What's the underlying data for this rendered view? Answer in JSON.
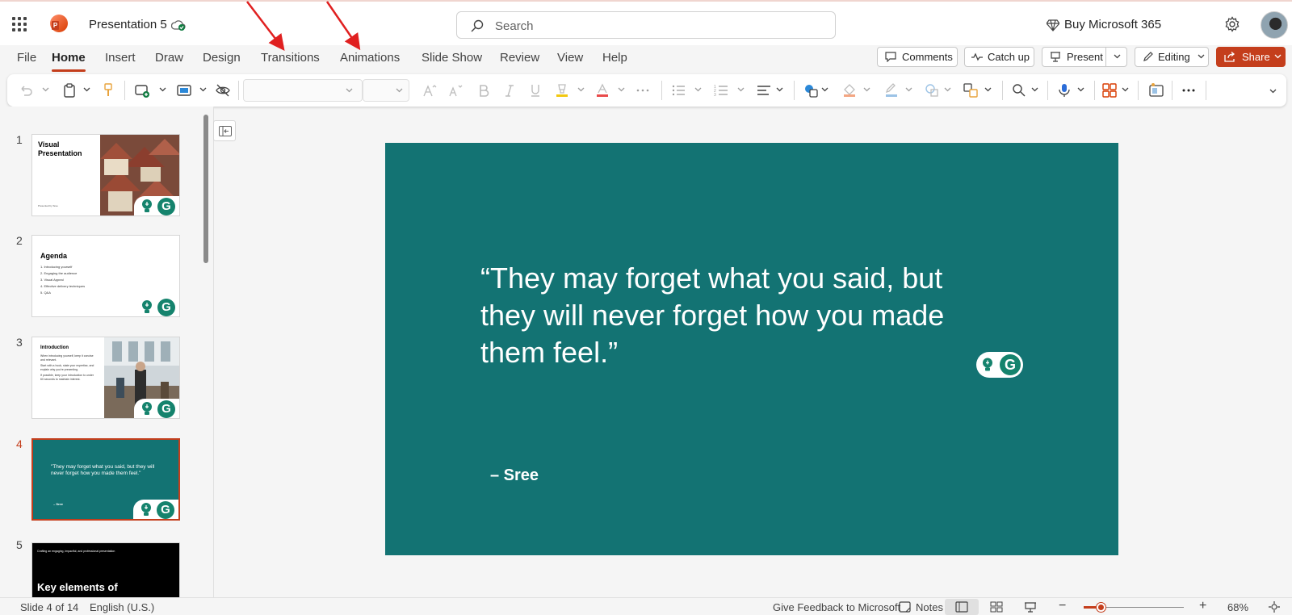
{
  "titlebar": {
    "doc_title": "Presentation 5",
    "search_placeholder": "Search",
    "buy": "Buy Microsoft 365"
  },
  "tabs": [
    "File",
    "Home",
    "Insert",
    "Draw",
    "Design",
    "Transitions",
    "Animations",
    "Slide Show",
    "Review",
    "View",
    "Help"
  ],
  "active_tab": "Home",
  "ribbon_buttons": {
    "comments": "Comments",
    "catch_up": "Catch up",
    "present": "Present",
    "editing": "Editing",
    "share": "Share"
  },
  "slides": [
    {
      "number": "1",
      "title": "Visual Presentation",
      "subtitle": "Presented by Sree"
    },
    {
      "number": "2",
      "title": "Agenda",
      "items": [
        "1.  Introducing yourself",
        "2.  Engaging the audience",
        "3.  Visual Appeal",
        "4.  Effective delivery techniques",
        "5.  Q&A"
      ]
    },
    {
      "number": "3",
      "title": "Introduction",
      "body": [
        "When introducing yourself, keep it concise and relevant.",
        "Start with a hook, state your expertise, and explain why you're presenting.",
        "If possible, keep your introduction to under 60 seconds to maintain interest."
      ]
    },
    {
      "number": "4",
      "quote": "\"They may forget what you said, but they will never forget how you made them feel.\"",
      "author": "– Sree"
    },
    {
      "number": "5",
      "subtitle": "Crafting an engaging, impactful, and professional presentation",
      "title": "Key elements of"
    }
  ],
  "current_slide": {
    "quote": "“They may forget what you said, but\n they will never forget how you made\n them feel.”",
    "author": "– Sree"
  },
  "status": {
    "slide_count": "Slide 4 of 14",
    "language": "English (U.S.)",
    "feedback": "Give Feedback to Microsoft",
    "notes": "Notes",
    "zoom": "68%",
    "zoom_level_percent": 68
  },
  "colors": {
    "accent": "#c43e1c",
    "slide_bg": "#137373",
    "annotation_arrow": "#e02020"
  },
  "annotations": [
    "arrow pointing to Transitions tab",
    "arrow pointing to Animations tab"
  ]
}
